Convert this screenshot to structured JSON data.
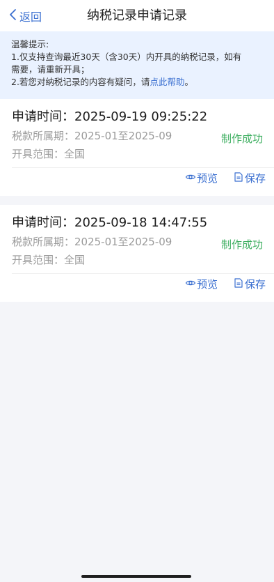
{
  "nav": {
    "back_label": "返回",
    "title": "纳税记录申请记录"
  },
  "notice": {
    "heading": "温馨提示:",
    "line1": "1.仅支持查询最近30天（含30天）内开具的纳税记录，如有",
    "line2": "需要，请重新开具；",
    "line3_prefix": "2.若您对纳税记录的内容有疑问，请",
    "help_link": "点此帮助",
    "line3_suffix": "。"
  },
  "records": [
    {
      "title": "申请时间：2025-09-19 09:25:22",
      "period": "税款所属期：2025-01至2025-09",
      "range": "开具范围：全国",
      "status": "制作成功",
      "preview_label": "预览",
      "save_label": "保存"
    },
    {
      "title": "申请时间：2025-09-18 14:47:55",
      "period": "税款所属期：2025-01至2025-09",
      "range": "开具范围：全国",
      "status": "制作成功",
      "preview_label": "预览",
      "save_label": "保存"
    }
  ],
  "colors": {
    "accent": "#3a6fd0",
    "success": "#3cae5f",
    "notice_bg": "#eaf2ff",
    "page_bg": "#f4f5f9"
  },
  "icons": {
    "back": "chevron-left-icon",
    "preview": "eye-icon",
    "save": "document-save-icon"
  }
}
